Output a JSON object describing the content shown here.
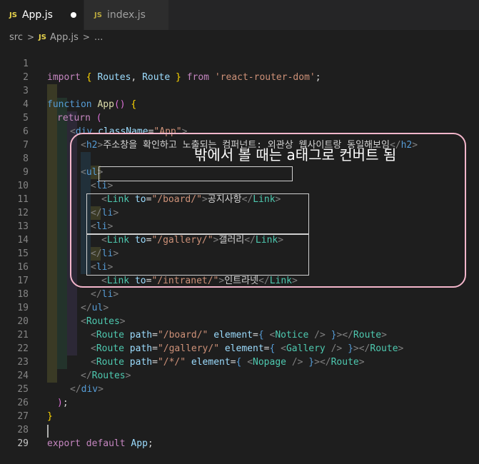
{
  "tabs": [
    {
      "icon": "JS",
      "label": "App.js",
      "dirty": true
    },
    {
      "icon": "JS",
      "label": "index.js"
    }
  ],
  "breadcrumb": {
    "folder": "src",
    "file_icon": "JS",
    "file": "App.js",
    "more": "..."
  },
  "annotation": {
    "text": "밖에서 볼 때는 a태그로 컨버트 됨"
  },
  "lines": [
    {
      "n": "1"
    },
    {
      "n": "2"
    },
    {
      "n": "3"
    },
    {
      "n": "4"
    },
    {
      "n": "5"
    },
    {
      "n": "6"
    },
    {
      "n": "7"
    },
    {
      "n": "8"
    },
    {
      "n": "9"
    },
    {
      "n": "10"
    },
    {
      "n": "11"
    },
    {
      "n": "12"
    },
    {
      "n": "13"
    },
    {
      "n": "14"
    },
    {
      "n": "15"
    },
    {
      "n": "16"
    },
    {
      "n": "17"
    },
    {
      "n": "18"
    },
    {
      "n": "19"
    },
    {
      "n": "20"
    },
    {
      "n": "21"
    },
    {
      "n": "22"
    },
    {
      "n": "23"
    },
    {
      "n": "24"
    },
    {
      "n": "25"
    },
    {
      "n": "26"
    },
    {
      "n": "27"
    },
    {
      "n": "28"
    },
    {
      "n": "29"
    }
  ],
  "code": {
    "l1": {
      "import": "import",
      "lb": "{",
      "routes": "Routes",
      "comma": ",",
      "route": "Route",
      "rb": "}",
      "from": "from",
      "pkg": "'react-router-dom'",
      "semi": ";"
    },
    "l3": {
      "function": "function",
      "name": "App",
      "paren": "()",
      "brace": "{"
    },
    "l4": {
      "return": "return",
      "paren": "("
    },
    "l5": {
      "open": "<",
      "tag": "div",
      "attr": "className",
      "eq": "=",
      "val": "\"App\"",
      "close": ">"
    },
    "l6": {
      "open": "<",
      "tag": "h2",
      "close": ">",
      "text": "주소창을 확인하고 노출되는 컴퍼넌트: 외관상 웹사이트랑 동일해보임",
      "end_open": "</",
      "end_tag": "h2",
      "end_close": ">"
    },
    "l8": {
      "open": "<",
      "tag": "ul",
      "close": ">"
    },
    "l9": {
      "open": "<",
      "tag": "li",
      "close": ">"
    },
    "l10": {
      "open": "<",
      "tag": "Link",
      "attr": "to",
      "eq": "=",
      "val": "\"/board/\"",
      "close": ">",
      "text": "공지사항",
      "end_open": "</",
      "end_tag": "Link",
      "end_close": ">"
    },
    "l11": {
      "open": "</",
      "tag": "li",
      "close": ">"
    },
    "l12": {
      "open": "<",
      "tag": "li",
      "close": ">"
    },
    "l13": {
      "open": "<",
      "tag": "Link",
      "attr": "to",
      "eq": "=",
      "val": "\"/gallery/\"",
      "close": ">",
      "text": "갤러리",
      "end_open": "</",
      "end_tag": "Link",
      "end_close": ">"
    },
    "l14": {
      "open": "</",
      "tag": "li",
      "close": ">"
    },
    "l15": {
      "open": "<",
      "tag": "li",
      "close": ">"
    },
    "l16": {
      "open": "<",
      "tag": "Link",
      "attr": "to",
      "eq": "=",
      "val": "\"/intranet/\"",
      "close": ">",
      "text": "인트라넷",
      "end_open": "</",
      "end_tag": "Link",
      "end_close": ">"
    },
    "l17": {
      "open": "</",
      "tag": "li",
      "close": ">"
    },
    "l18": {
      "open": "</",
      "tag": "ul",
      "close": ">"
    },
    "l19": {
      "open": "<",
      "tag": "Routes",
      "close": ">"
    },
    "l20": {
      "open": "<",
      "tag": "Route",
      "attr1": "path",
      "eq": "=",
      "val1": "\"/board/\"",
      "attr2": "element",
      "lb": "{",
      "comp_open": "<",
      "comp": "Notice",
      "comp_close": "/>",
      "rb": "}",
      "close": ">",
      "end_open": "</",
      "end_tag": "Route",
      "end_close": ">"
    },
    "l21": {
      "open": "<",
      "tag": "Route",
      "attr1": "path",
      "eq": "=",
      "val1": "\"/gallery/\"",
      "attr2": "element",
      "lb": "{",
      "comp_open": "<",
      "comp": "Gallery",
      "comp_close": "/>",
      "rb": "}",
      "close": ">",
      "end_open": "</",
      "end_tag": "Route",
      "end_close": ">"
    },
    "l22": {
      "open": "<",
      "tag": "Route",
      "attr1": "path",
      "eq": "=",
      "val1": "\"/*/\"",
      "attr2": "element",
      "lb": "{",
      "comp_open": "<",
      "comp": "Nopage",
      "comp_close": "/>",
      "rb": "}",
      "close": ">",
      "end_open": "</",
      "end_tag": "Route",
      "end_close": ">"
    },
    "l23": {
      "open": "</",
      "tag": "Routes",
      "close": ">"
    },
    "l24": {
      "open": "</",
      "tag": "div",
      "close": ">"
    },
    "l25": {
      "paren": ")",
      "semi": ";"
    },
    "l26": {
      "brace": "}"
    },
    "l28": {
      "export": "export",
      "default": "default",
      "name": "App",
      "semi": ";"
    }
  },
  "colors": {
    "background": "#1e1e1e",
    "annotation_border": "#f4b6cb",
    "keyword": "#c586c0",
    "tag": "#569cd6",
    "component": "#4ec9b0",
    "string": "#ce9178"
  }
}
